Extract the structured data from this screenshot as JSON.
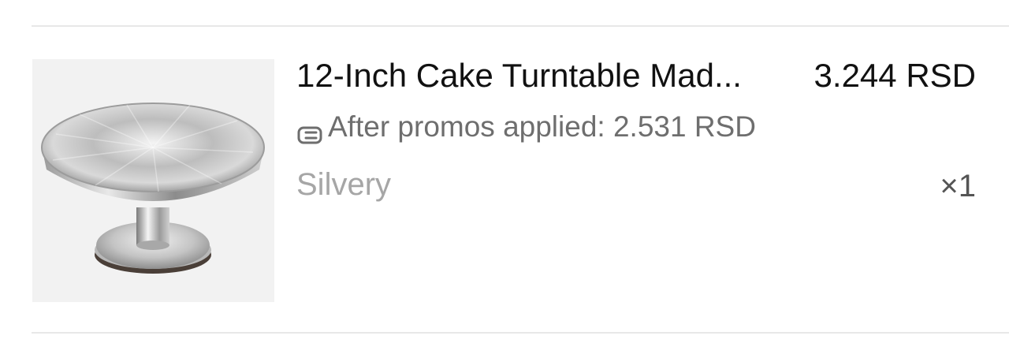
{
  "cart_item": {
    "title": "12-Inch Cake Turntable Mad...",
    "price": "3.244 RSD",
    "promo_text": "After promos applied: 2.531 RSD",
    "variant": "Silvery",
    "quantity": "×1",
    "promo_icon": "coupon-icon",
    "image_description_icon": "cake-turntable-image"
  },
  "colors": {
    "title": "#111111",
    "promo": "#6e6e6e",
    "variant": "#a6a6a6",
    "divider": "#e8e8e8",
    "thumb_bg": "#f2f2f2"
  }
}
